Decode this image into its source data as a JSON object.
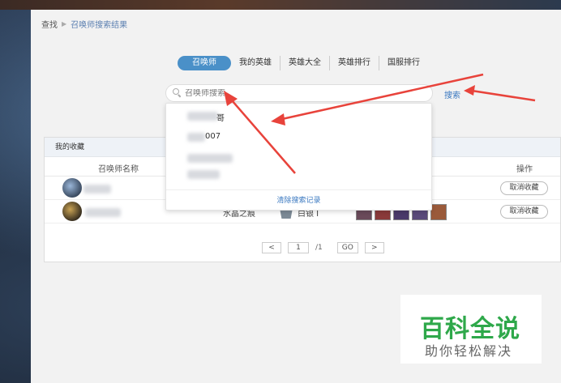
{
  "breadcrumb": {
    "root": "查找",
    "current": "召唤师搜索结果"
  },
  "tabs": [
    {
      "label": "召唤师",
      "active": true
    },
    {
      "label": "我的英雄",
      "active": false
    },
    {
      "label": "英雄大全",
      "active": false
    },
    {
      "label": "英雄排行",
      "active": false
    },
    {
      "label": "国服排行",
      "active": false
    }
  ],
  "search": {
    "placeholder": "召唤师搜索",
    "button_label": "搜索"
  },
  "dropdown": {
    "items": [
      "哥",
      "007",
      ""
    ],
    "clear_label": "清除搜索记录"
  },
  "favorites": {
    "title": "我的收藏",
    "columns": {
      "name": "召唤师名称",
      "action": "操作"
    },
    "rows": [
      {
        "name": "",
        "server": "",
        "rank": "",
        "action": "取消收藏"
      },
      {
        "name": "",
        "server": "水晶之痕",
        "rank": "白银 I",
        "action": "取消收藏"
      }
    ],
    "pager": {
      "prev": "<",
      "page": "1",
      "total": "/1",
      "go": "GO",
      "next": ">"
    }
  },
  "watermark": {
    "title": "百科全说",
    "subtitle": "助你轻松解决"
  },
  "colors": {
    "accent": "#4a90c8",
    "link": "#3a78c0",
    "arrow": "#e8433b",
    "brand_green": "#2ea84a"
  }
}
